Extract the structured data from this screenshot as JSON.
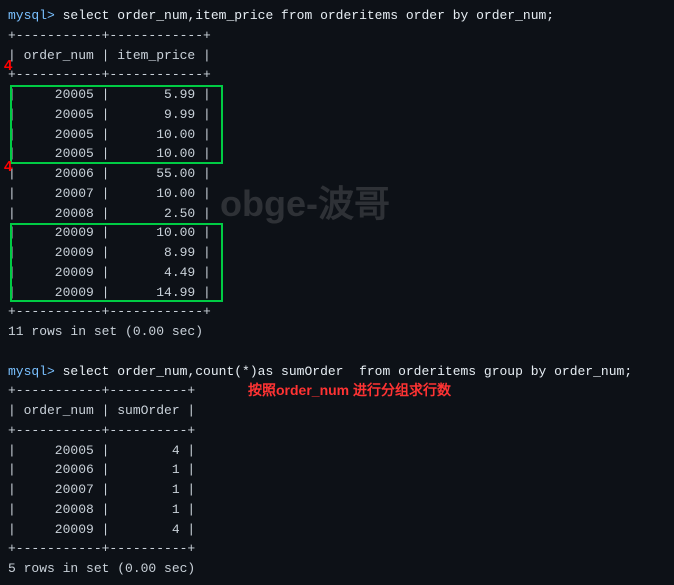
{
  "terminal": {
    "background": "#0d1117",
    "prompt": "mysql>",
    "query1": "select order_num,item_price from orderitems order by order_num;",
    "query2": "select order_num,count(*)as sumOrder  from orderitems group by order_num;",
    "table1": {
      "header_sep": "+-----------+------------+",
      "header_row": "| order_num | item_price |",
      "rows": [
        "| 20005     |       5.99 |",
        "| 20005     |       9.99 |",
        "| 20005     |      10.00 |",
        "| 20005     |      10.00 |",
        "| 20006     |      55.00 |",
        "| 20007     |      10.00 |",
        "| 20008     |       2.50 |",
        "| 20009     |      10.00 |",
        "| 20009     |       8.99 |",
        "| 20009     |       4.49 |",
        "| 20009     |      14.99 |"
      ],
      "footer_sep": "+-----------+------------+",
      "result": "11 rows in set (0.00 sec)"
    },
    "table2": {
      "header_sep": "+-----------+----------+",
      "header_row": "| order_num | sumOrder |",
      "rows": [
        "|     20005 |        4 |",
        "|     20006 |        1 |",
        "|     20007 |        1 |",
        "|     20008 |        1 |",
        "|     20009 |        4 |"
      ],
      "footer_sep": "+-----------+----------+",
      "result": "5 rows in set (0.00 sec)"
    },
    "watermark": "obge-波哥",
    "annotation1_label": "4",
    "annotation2_label": "4",
    "annotation3_text": "按照order_num 进行分组求行数"
  }
}
